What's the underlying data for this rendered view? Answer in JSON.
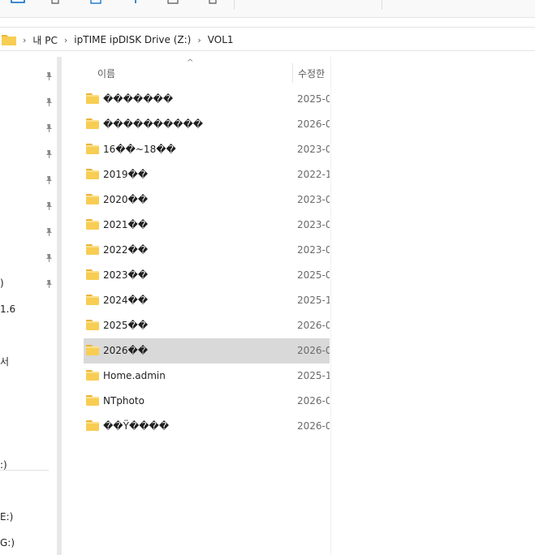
{
  "address": {
    "crumbs": [
      "내 PC",
      "ipTIME ipDISK Drive (Z:)",
      "VOL1"
    ]
  },
  "nav": {
    "partial_labels": [
      ")",
      "1.6",
      "서",
      ":)",
      "E:)",
      "G:)"
    ]
  },
  "columns": {
    "name": "이름",
    "date": "수정한"
  },
  "files": [
    {
      "name": "�������",
      "date": "2025-0"
    },
    {
      "name": "����������",
      "date": "2026-0"
    },
    {
      "name": "16��~18��",
      "date": "2023-0"
    },
    {
      "name": "2019��",
      "date": "2022-1"
    },
    {
      "name": "2020��",
      "date": "2023-0"
    },
    {
      "name": "2021��",
      "date": "2023-0"
    },
    {
      "name": "2022��",
      "date": "2023-0"
    },
    {
      "name": "2023��",
      "date": "2025-0"
    },
    {
      "name": "2024��",
      "date": "2025-1"
    },
    {
      "name": "2025��",
      "date": "2026-0"
    },
    {
      "name": "2026��",
      "date": "2026-0",
      "selected": true
    },
    {
      "name": "Home.admin",
      "date": "2025-1"
    },
    {
      "name": "NTphoto",
      "date": "2026-0"
    },
    {
      "name": "��Ÿ����",
      "date": "2026-0"
    }
  ],
  "colors": {
    "folder": "#f8cd53",
    "selected_row": "#d9d9d9",
    "accent": "#0067c0"
  }
}
